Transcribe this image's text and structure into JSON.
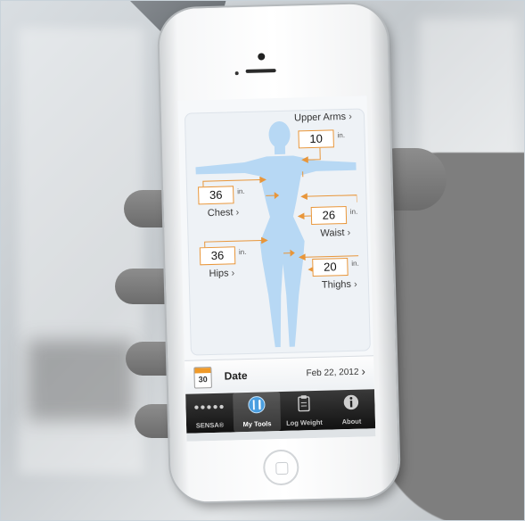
{
  "measurements": {
    "upper_arms": {
      "label": "Upper Arms",
      "value": "10",
      "unit": "in."
    },
    "chest": {
      "label": "Chest",
      "value": "36",
      "unit": "in."
    },
    "waist": {
      "label": "Waist",
      "value": "26",
      "unit": "in."
    },
    "hips": {
      "label": "Hips",
      "value": "36",
      "unit": "in."
    },
    "thighs": {
      "label": "Thighs",
      "value": "20",
      "unit": "in."
    },
    "chevron": "›"
  },
  "date_row": {
    "icon": "calendar-icon",
    "icon_day": "30",
    "label": "Date",
    "value": "Feb 22, 2012",
    "chevron": "›"
  },
  "tabbar": {
    "tabs": [
      {
        "label": "SENSA®",
        "icon": "dots-icon",
        "active": false
      },
      {
        "label": "My Tools",
        "icon": "fork-knife-icon",
        "active": true
      },
      {
        "label": "Log Weight",
        "icon": "clipboard-icon",
        "active": false
      },
      {
        "label": "About",
        "icon": "info-icon",
        "active": false
      }
    ]
  },
  "colors": {
    "accent_orange": "#e8963a",
    "silhouette_blue": "#b7d8f4",
    "tabbar_dark": "#111111"
  }
}
